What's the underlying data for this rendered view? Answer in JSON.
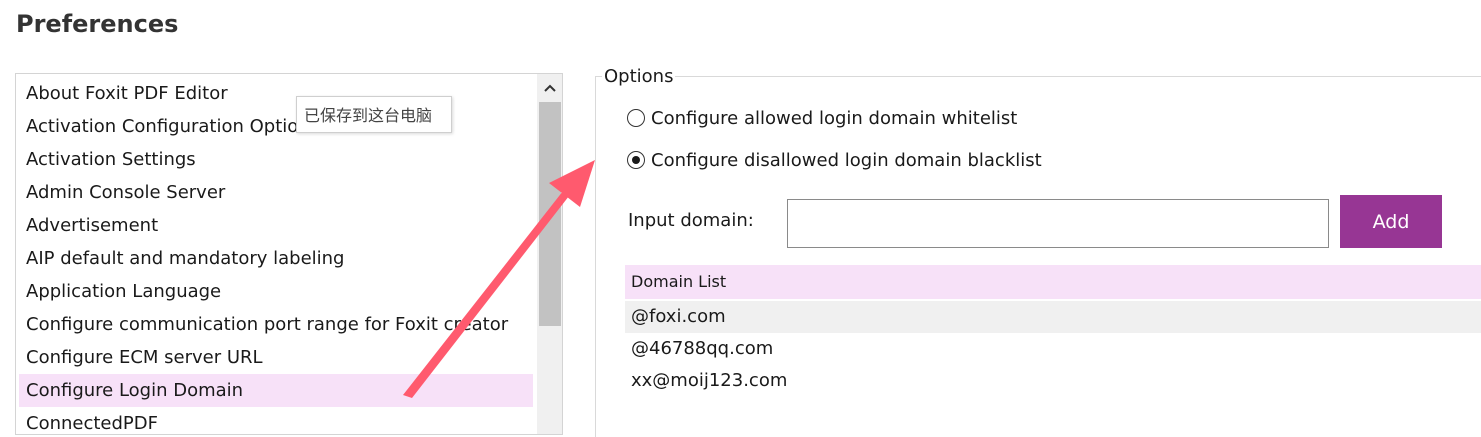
{
  "page": {
    "title": "Preferences"
  },
  "sidebar": {
    "items": [
      {
        "label": "About Foxit PDF Editor"
      },
      {
        "label": "Activation Configuration Options"
      },
      {
        "label": "Activation Settings"
      },
      {
        "label": "Admin Console Server"
      },
      {
        "label": "Advertisement"
      },
      {
        "label": "AIP default and mandatory labeling"
      },
      {
        "label": "Application Language"
      },
      {
        "label": "Configure communication port range for Foxit creator"
      },
      {
        "label": "Configure ECM server URL"
      },
      {
        "label": "Configure Login Domain",
        "selected": true
      },
      {
        "label": "ConnectedPDF"
      }
    ],
    "tooltip": "已保存到这台电脑"
  },
  "options": {
    "legend": "Options",
    "radio_whitelist": {
      "label": "Configure allowed login domain whitelist",
      "checked": false
    },
    "radio_blacklist": {
      "label": "Configure disallowed login domain blacklist",
      "checked": true
    },
    "input_label": "Input domain:",
    "input_value": "",
    "add_label": "Add",
    "domain_list_header": "Domain List",
    "domains": [
      "@foxi.com",
      "@46788qq.com",
      "xx@moij123.com"
    ]
  },
  "colors": {
    "accent": "#973694",
    "selection": "#f7e1f8",
    "annotation_arrow": "#ff5a6e"
  },
  "icons": {
    "scroll_up": "chevron-up-icon",
    "annotation": "arrow-annotation-icon"
  }
}
